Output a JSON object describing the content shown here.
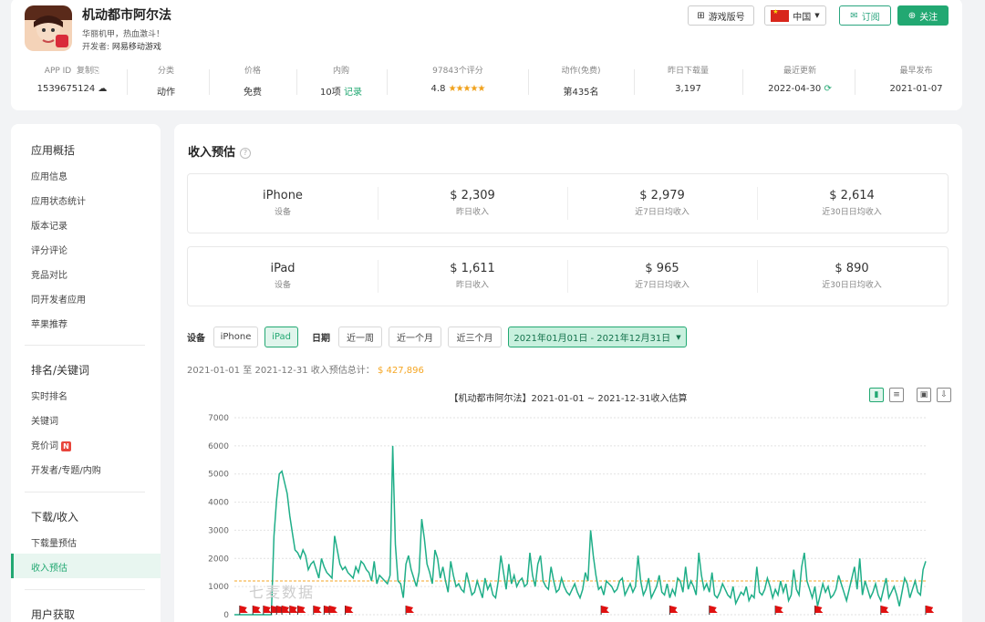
{
  "app": {
    "name": "机动都市阿尔法",
    "slogan": "华丽机甲，热血激斗！",
    "developer_label": "开发者:",
    "developer": "网易移动游戏"
  },
  "actions": {
    "version_btn": "游戏版号",
    "country": "中国",
    "subscribe": "订阅",
    "follow": "关注"
  },
  "stats": [
    {
      "key": "APP ID",
      "extra": "复制",
      "value": "1539675124"
    },
    {
      "key": "分类",
      "value": "动作"
    },
    {
      "key": "价格",
      "value": "免费"
    },
    {
      "key": "内购",
      "value": "10项",
      "link": "记录"
    },
    {
      "key": "97843个评分",
      "value": "4.8",
      "stars": "★★★★★"
    },
    {
      "key": "动作(免费)",
      "value": "第435名"
    },
    {
      "key": "昨日下载量",
      "value": "3,197"
    },
    {
      "key": "最近更新",
      "value": "2022-04-30"
    },
    {
      "key": "最早发布",
      "value": "2021-01-07"
    }
  ],
  "sidebar": {
    "groups": [
      {
        "title": "应用概括",
        "items": [
          "应用信息",
          "应用状态统计",
          "版本记录",
          "评分评论",
          "竞品对比",
          "同开发者应用",
          "苹果推荐"
        ]
      },
      {
        "title": "排名/关键词",
        "items": [
          "实时排名",
          "关键词",
          "竞价词",
          "开发者/专题/内购"
        ]
      },
      {
        "title": "下载/收入",
        "items": [
          "下载量预估",
          "收入预估"
        ]
      },
      {
        "title": "用户获取",
        "items": []
      }
    ],
    "badge": "N"
  },
  "revenue": {
    "title": "收入预估",
    "help": "?",
    "iphone": {
      "device": "iPhone",
      "device_sub": "设备",
      "cells": [
        {
          "value": "$ 2,309",
          "label": "昨日收入"
        },
        {
          "value": "$ 2,979",
          "label": "近7日日均收入"
        },
        {
          "value": "$ 2,614",
          "label": "近30日日均收入"
        }
      ]
    },
    "ipad": {
      "device": "iPad",
      "device_sub": "设备",
      "cells": [
        {
          "value": "$ 1,611",
          "label": "昨日收入"
        },
        {
          "value": "$ 965",
          "label": "近7日日均收入"
        },
        {
          "value": "$ 890",
          "label": "近30日日均收入"
        }
      ]
    }
  },
  "filters": {
    "device_label": "设备",
    "devices": [
      "iPhone",
      "iPad"
    ],
    "date_label": "日期",
    "ranges": [
      "近一周",
      "近一个月",
      "近三个月"
    ],
    "custom_range": "2021年01月01日 - 2021年12月31日"
  },
  "total": {
    "text": "2021-01-01 至 2021-12-31 收入预估总计：",
    "value": "$ 427,896"
  },
  "watermark": "七麦数据",
  "chart_data": {
    "type": "line",
    "title": "【机动都市阿尔法】2021-01-01 ~ 2021-12-31收入估算",
    "y_ticks": [
      0,
      1000,
      2000,
      3000,
      4000,
      5000,
      6000,
      7000
    ],
    "ylim": [
      0,
      7000
    ],
    "average_line": 1200,
    "line_color": "#1fae88",
    "average_color": "#f5a623",
    "series": [
      {
        "values": [
          0,
          0,
          0,
          0,
          0,
          0,
          0,
          0,
          0,
          0,
          0,
          0,
          0,
          0,
          0,
          2800,
          4100,
          5000,
          5100,
          4700,
          4300,
          3500,
          2900,
          2300,
          2200,
          2000,
          2300,
          2100,
          1600,
          1800,
          1900,
          1600,
          1300,
          2000,
          1700,
          1500,
          1400,
          1300,
          2800,
          2300,
          1800,
          1600,
          1700,
          1500,
          1400,
          1300,
          1700,
          1500,
          1900,
          1800,
          1600,
          1500,
          1200,
          1900,
          1100,
          1400,
          1300,
          1200,
          1100,
          1400,
          6000,
          2500,
          1200,
          1100,
          600,
          1800,
          2100,
          1600,
          1300,
          1000,
          1500,
          3400,
          2700,
          1800,
          1500,
          1100,
          2300,
          2000,
          1300,
          1700,
          1200,
          800,
          1900,
          1400,
          1000,
          1100,
          900,
          800,
          1500,
          1100,
          700,
          800,
          1200,
          900,
          600,
          1300,
          900,
          1100,
          700,
          600,
          1200,
          2100,
          1500,
          900,
          1800,
          1100,
          1400,
          1000,
          1200,
          1300,
          1000,
          1100,
          2200,
          1400,
          1000,
          1800,
          2100,
          1200,
          1000,
          900,
          1700,
          1200,
          800,
          900,
          1300,
          1000,
          800,
          700,
          900,
          1100,
          800,
          600,
          900,
          1500,
          1200,
          3000,
          2100,
          1400,
          900,
          1000,
          700,
          1200,
          1100,
          1000,
          800,
          900,
          1200,
          1300,
          700,
          900,
          1100,
          800,
          1000,
          2100,
          1200,
          700,
          900,
          1300,
          600,
          800,
          1000,
          1400,
          800,
          700,
          1100,
          600,
          900,
          700,
          1300,
          1200,
          800,
          1700,
          900,
          1200,
          1000,
          700,
          2200,
          1400,
          900,
          1100,
          800,
          1500,
          700,
          600,
          800,
          1100,
          900,
          700,
          600,
          1000,
          400,
          600,
          800,
          700,
          1000,
          500,
          700,
          600,
          1700,
          800,
          700,
          900,
          1300,
          1000,
          600,
          900,
          700,
          1200,
          800,
          1100,
          500,
          700,
          1600,
          900,
          700,
          1700,
          2200,
          1200,
          900,
          600,
          1000,
          300,
          700,
          1100,
          800,
          1000,
          600,
          700,
          900,
          1400,
          1100,
          800,
          500,
          900,
          1300,
          1700,
          900,
          2000,
          700,
          1200,
          900,
          600,
          800,
          1100,
          700,
          500,
          900,
          1300,
          600,
          800,
          1000,
          700,
          300,
          800,
          1300,
          1100,
          600,
          900,
          1200,
          800,
          700,
          1600,
          1900
        ]
      }
    ],
    "flags_at_index": [
      2,
      7,
      11,
      14,
      16,
      18,
      21,
      24,
      30,
      34,
      36,
      42,
      65,
      139,
      165,
      180,
      205,
      220,
      245,
      272,
      286,
      290,
      300
    ]
  }
}
